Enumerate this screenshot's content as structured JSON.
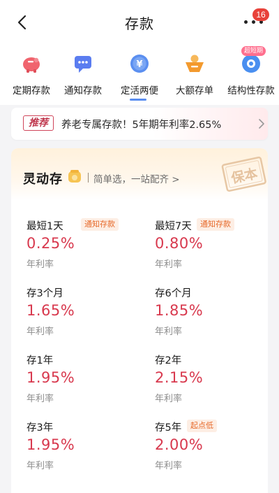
{
  "header": {
    "title": "存款",
    "badge": "16",
    "icons": {
      "back": "chevron-left-icon",
      "more": "more-dots-icon"
    }
  },
  "nav": {
    "items": [
      {
        "label": "定期存款",
        "icon": "piggy-bank-icon",
        "color": "#f0646e"
      },
      {
        "label": "通知存款",
        "icon": "message-icon",
        "color": "#5b7df0"
      },
      {
        "label": "定活两便",
        "icon": "yuan-coin-icon",
        "color": "#5b8ff0"
      },
      {
        "label": "大额存单",
        "icon": "certificate-icon",
        "color": "#f39a2e"
      },
      {
        "label": "结构性存款",
        "icon": "structured-icon",
        "color": "#4a8ff0",
        "tag": "超短期"
      }
    ],
    "selected_index": 2
  },
  "recommend": {
    "tag": "推荐",
    "text": "养老专属存款！5年期年利率2.65%"
  },
  "card": {
    "title": "灵动存",
    "subtitle": "简单选，一站配齐 >",
    "seal_text": "保本",
    "rate_label": "年利率",
    "products": [
      {
        "term": "最短1天",
        "tag": "通知存款",
        "rate": "0.25%"
      },
      {
        "term": "最短7天",
        "tag": "通知存款",
        "rate": "0.80%"
      },
      {
        "term": "存3个月",
        "rate": "1.65%"
      },
      {
        "term": "存6个月",
        "rate": "1.85%"
      },
      {
        "term": "存1年",
        "rate": "1.95%"
      },
      {
        "term": "存2年",
        "rate": "2.15%"
      },
      {
        "term": "存3年",
        "rate": "1.95%"
      },
      {
        "term": "存5年",
        "tag": "起点低",
        "rate": "2.00%"
      }
    ]
  },
  "colors": {
    "accent_red": "#d8394e",
    "tag_orange": "#e76a2b",
    "nav_indicator": "#5a8ef0"
  }
}
